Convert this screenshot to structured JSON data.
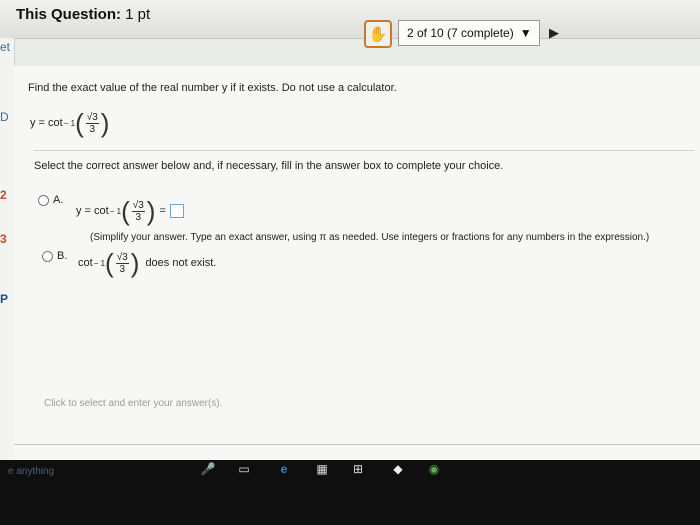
{
  "header": {
    "title_label": "This Question:",
    "title_points": "1 pt",
    "progress_text": "2 of 10 (7 complete)",
    "dropdown_glyph": "▼",
    "next_glyph": "▶",
    "prev_glyph": "✋"
  },
  "left_marks": [
    "et",
    "D",
    "2",
    "3",
    "P"
  ],
  "question": {
    "prompt": "Find the exact value of the real number y if it exists. Do not use a calculator.",
    "lhs": "y = cot",
    "exponent": "− 1",
    "numerator": "√3",
    "denominator": "3",
    "select_prompt": "Select the correct answer below and, if necessary, fill in the answer box to complete your choice."
  },
  "options": [
    {
      "letter": "A.",
      "lhs": "y = cot",
      "exponent": "− 1",
      "numerator": "√3",
      "denominator": "3",
      "equals": "=",
      "note": "(Simplify your answer. Type an exact answer, using π as needed. Use integers or fractions for any numbers in the expression.)"
    },
    {
      "letter": "B.",
      "lhs": "cot",
      "exponent": "− 1",
      "numerator": "√3",
      "denominator": "3",
      "suffix": "does not exist."
    }
  ],
  "footer_note": "Click to select and enter your answer(s).",
  "taskbar": {
    "search_hint": "e anything",
    "icons": [
      "microphone-icon",
      "task-view-icon",
      "edge-icon",
      "store-icon",
      "windows-store-icon",
      "app-icon",
      "chrome-icon"
    ],
    "glyphs": [
      "🎤",
      "▭",
      "e",
      "▦",
      "⊞",
      "◆",
      "◉"
    ]
  },
  "colors": {
    "accent_border": "#c87a2b",
    "answer_box_border": "#6aa5d8",
    "edge_blue": "#1f8fd6"
  }
}
